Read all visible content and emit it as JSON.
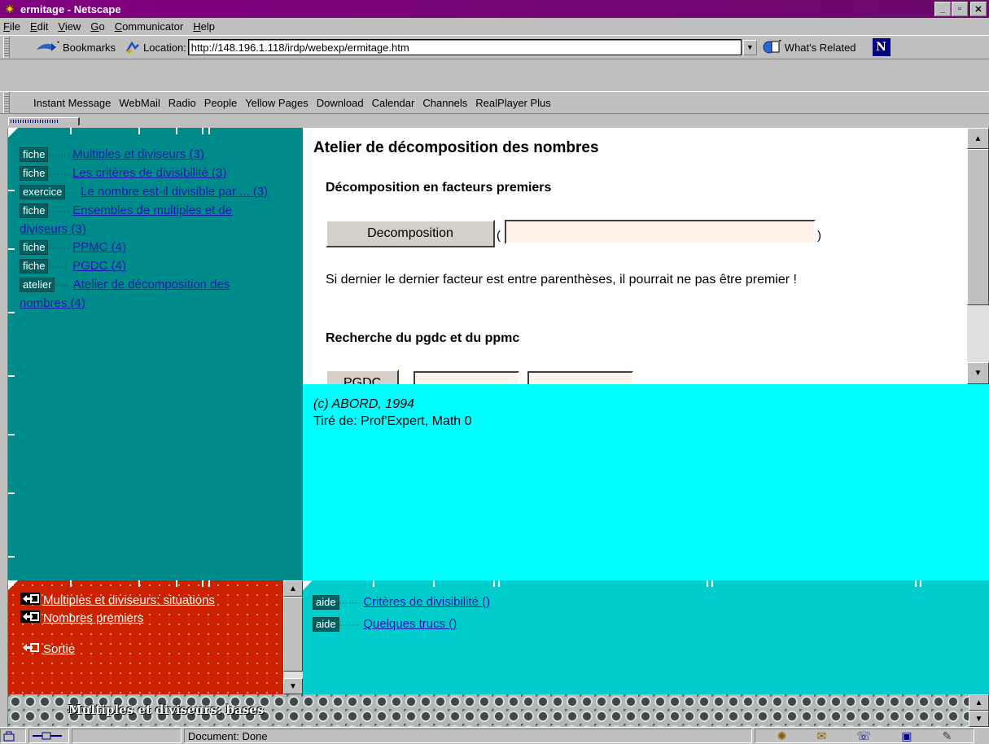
{
  "window": {
    "title": "ermitage - Netscape",
    "controls": [
      "_",
      "▫",
      "✕"
    ]
  },
  "menu": [
    "File",
    "Edit",
    "View",
    "Go",
    "Communicator",
    "Help"
  ],
  "location_bar": {
    "bookmarks_label": "Bookmarks",
    "location_label": "Location:",
    "url": "http://148.196.1.118/irdp/webexp/ermitage.htm",
    "whats_related": "What's Related"
  },
  "personal_toolbar": [
    "Instant Message",
    "WebMail",
    "Radio",
    "People",
    "Yellow Pages",
    "Download",
    "Calendar",
    "Channels",
    "RealPlayer Plus"
  ],
  "nav_frame": {
    "items": [
      {
        "tag": "fiche",
        "title": "Multiples et diviseurs (3)"
      },
      {
        "tag": "fiche",
        "title": "Les critères de divisibilité (3)"
      },
      {
        "tag": "exercice",
        "title": "Le nombre est-il divisible par ... (3)"
      },
      {
        "tag": "fiche",
        "title": "Ensembles de multiples et de diviseurs (3)"
      },
      {
        "tag": "fiche",
        "title": "PPMC (4)"
      },
      {
        "tag": "fiche",
        "title": "PGDC (4)"
      },
      {
        "tag": "atelier",
        "title": "Atelier de décomposition des nombres (4)"
      }
    ]
  },
  "main": {
    "heading": "Atelier de décomposition des nombres",
    "section1": "Décomposition en facteurs premiers",
    "decomp_button": "Decomposition",
    "paren_open": "(",
    "paren_close": ")",
    "note": "Si dernier le dernier facteur est entre parenthèses, il pourrait ne pas être premier !",
    "section2": "Recherche du pgdc et du ppmc",
    "pgdc_button": "PGDC"
  },
  "info": {
    "line1": "(c) ABORD, 1994",
    "line2": "Tiré de: Prof'Expert, Math 0"
  },
  "bottom_nav": [
    "Multiples et diviseurs: situations",
    "Nombres premiers",
    "Sortie"
  ],
  "help_frame": [
    {
      "tag": "aide",
      "title": "Critères de divisibilité ()"
    },
    {
      "tag": "aide",
      "title": "Quelques trucs ()"
    }
  ],
  "bottom_title": "Multiples et diviseurs: bases",
  "status": {
    "text": "Document: Done"
  },
  "colors": {
    "titlebar": "#800080",
    "nav_bg": "#008b8b",
    "info_bg": "#00ffff",
    "bottomleft_bg": "#cc2200",
    "help_bg": "#00cccc"
  }
}
